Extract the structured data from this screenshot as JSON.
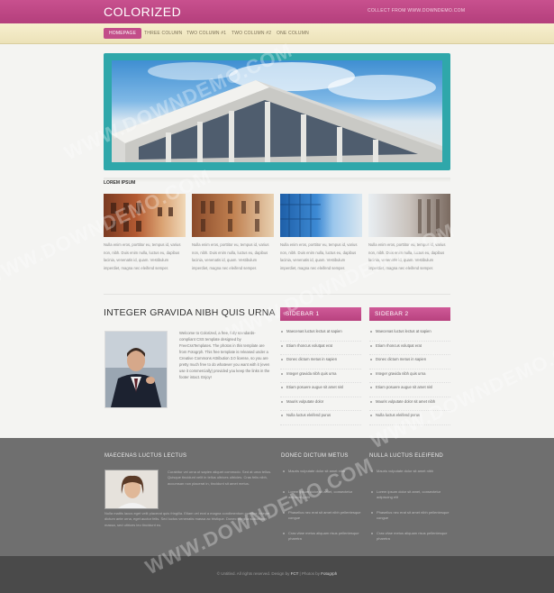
{
  "header": {
    "logo": "COLORIZED",
    "tagline": "COLLECT FROM WWW.DOWNDEMO.COM"
  },
  "nav": {
    "items": [
      "HOMEPAGE",
      "THREE COLUMN",
      "TWO COLUMN #1",
      "TWO COLUMN #2",
      "ONE COLUMN"
    ],
    "active": "HOMEPAGE"
  },
  "section": {
    "label": "LOREM IPSUM"
  },
  "thumbs": [
    {
      "text": "Nulla enim eros, porttitor eu, tempus id, varius non, nibh. Duis enim nulla, luctus eu, dapibus lacinia, venenatis id, quam. Vestibulum imperdiet, magna nec eleifend semper."
    },
    {
      "text": "Nulla enim eros, porttitor eu, tempus id, varius non, nibh. Duis enim nulla, luctus eu, dapibus lacinia, venenatis id, quam. Vestibulum imperdiet, magna nec eleifend semper."
    },
    {
      "text": "Nulla enim eros, porttitor eu, tempus id, varius non, nibh. Duis enim nulla, luctus eu, dapibus lacinia, venenatis id, quam. Vestibulum imperdiet, magna nec eleifend semper."
    },
    {
      "text": "Nulla enim eros, porttitor eu, tempus id, varius non, nibh. Duis enim nulla, luctus eu, dapibus lacinia, venenatis id, quam. Vestibulum imperdiet, magna nec eleifend semper."
    }
  ],
  "article": {
    "title": "INTEGER GRAVIDA NIBH QUIS URNA",
    "text": "Welcome to Colorized, a free, fully standards-compliant CSS template designed by FreeCssTemplates. The photos in this template are from Fotogrph. This free template is released under a Creative Commons Attribution 3.0 license, so you are pretty much free to do whatever you want with it (even use it commercially) provided you keep the links in the footer intact. Enjoy!"
  },
  "sidebar1": {
    "title": "SIDEBAR 1",
    "items": [
      "Maecenas luctus lectus at sapien",
      "Etiam rhoncus volutpat erat",
      "Donec dictum metus in sapien",
      "Integer gravida nibh quis urna",
      "Etiam posuere augue sit amet nisl",
      "Mauris vulputate dolor",
      "Nulla luctus eleifend purus"
    ]
  },
  "sidebar2": {
    "title": "SIDEBAR 2",
    "items": [
      "Maecenas luctus lectus at sapien",
      "Etiam rhoncus volutpat erat",
      "Donec dictum metus in sapien",
      "Integer gravida nibh quis urna",
      "Etiam posuere augue sit amet nisl",
      "Mauris vulputate dolor sit amet nibh",
      "Nulla luctus eleifend purus"
    ]
  },
  "footer": {
    "col1_title": "MAECENAS LUCTUS LECTUS",
    "col1_text": "Curabitur vel urna ut sapien aliquet commodo. Sed at urna tellus. Quisque tincidunt velit in tellus ultrices ultricies. Cras felis nibh, accumsan non placerat in, tincidunt sit amet metus.",
    "col1_text2": "Nulla mattis lacus eget velit placerat quis fringilla. Etiam vel erat a magna condimentum porttitor. Integer dictum ante urna, eget auctor felis. Sed luctus venenatis massa ac tristique. Donec fringilla sollicitudin massa, sed ultrices leo tincidunt eu.",
    "col2_title": "DONEC DICTUM METUS",
    "col2_items": [
      "Mauris vulputate dolor sit amet nibh",
      "Lorem ipsum dolor sit amet, consectetur adipiscing elit",
      "Phasellus nec erat sit amet nibh pellentesque congue",
      "Cras vitae metus aliquam risus pellentesque pharetra"
    ],
    "col3_title": "NULLA LUCTUS ELEIFEND",
    "col3_items": [
      "Mauris vulputate dolor sit amet nibh",
      "Lorem ipsum dolor sit amet, consectetur adipiscing elit",
      "Phasellus nec erat sit amet nibh pellentesque congue",
      "Cras vitae metus aliquam risus pellentesque pharetra"
    ]
  },
  "credits": {
    "prefix": "© Untitled. All rights reserved. Design by",
    "link1": "FCT",
    "mid": "| Photos by",
    "link2": "Fotogrph"
  },
  "watermark": "WWW.DOWNDEMO.COM",
  "colors": {
    "brand": "#c24d89",
    "accent_frame": "#2fa7aa",
    "nav_bg": "#f2e8c4",
    "footer_bg": "#6f6f6f"
  }
}
